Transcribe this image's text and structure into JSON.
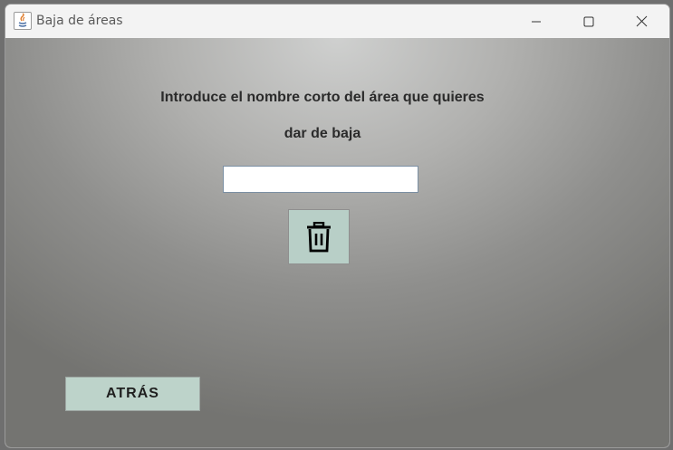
{
  "window": {
    "title": "Baja de áreas",
    "controls": [
      "minimize-icon",
      "maximize-icon",
      "close-icon"
    ]
  },
  "main": {
    "prompt_line1": "Introduce el nombre corto del área que quieres",
    "prompt_line2": "dar de baja",
    "area_input_value": "",
    "delete_icon": "trash-icon",
    "back_label": "ATRÁS"
  },
  "colors": {
    "button_bg": "#b8cfc7",
    "text": "#2b2b2b"
  }
}
